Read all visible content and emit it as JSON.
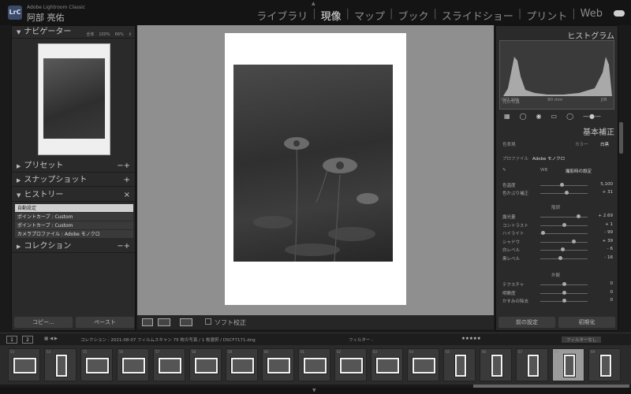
{
  "app": {
    "product": "Adobe Lightroom Classic",
    "user": "阿部 亮佑",
    "badge": "LrC"
  },
  "modules": [
    {
      "label": "ライブラリ",
      "active": false
    },
    {
      "label": "現像",
      "active": true
    },
    {
      "label": "マップ",
      "active": false
    },
    {
      "label": "ブック",
      "active": false
    },
    {
      "label": "スライドショー",
      "active": false
    },
    {
      "label": "プリント",
      "active": false
    },
    {
      "label": "Web",
      "active": false
    }
  ],
  "left": {
    "navigator": {
      "title": "ナビゲーター",
      "zoom_options": [
        "全体",
        "100%",
        "66%",
        "⇕"
      ]
    },
    "presets": "プリセット",
    "snapshots": "スナップショット",
    "history": {
      "title": "ヒストリー",
      "items": [
        {
          "label": "自動設定",
          "selected": true
        },
        {
          "label": "ポイントカーブ : Custom",
          "selected": false
        },
        {
          "label": "ポイントカーブ : Custom",
          "selected": false
        },
        {
          "label": "カメラプロファイル : Adobe モノクロ",
          "selected": false
        }
      ]
    },
    "collections": "コレクション",
    "copy_button": "コピー...",
    "paste_button": "ペースト"
  },
  "center": {
    "soft_proof": "ソフト校正"
  },
  "right": {
    "histogram_title": "ヒストグラム",
    "hist_info": {
      "iso": "ISO 200",
      "focal": "90 mm",
      "aperture": "ƒ/8"
    },
    "original_photo": "元の写真",
    "basic_title": "基本補正",
    "treatment_label": "色表現",
    "treatment_options": [
      "カラー",
      "白黒"
    ],
    "profile_label": "プロファイル",
    "profile_value": "Adobe モノクロ",
    "wb_label": "WB",
    "wb_value": "撮影時の設定",
    "sliders_wb": [
      {
        "label": "色温度",
        "value": "5,100",
        "pos": 0.45
      },
      {
        "label": "色かぶり補正",
        "value": "+ 31",
        "pos": 0.55
      }
    ],
    "tone_title": "階調",
    "sliders_tone": [
      {
        "label": "露光量",
        "value": "+ 2.69",
        "pos": 0.8
      },
      {
        "label": "コントラスト",
        "value": "+ 1",
        "pos": 0.5
      },
      {
        "label": "ハイライト",
        "value": "- 99",
        "pos": 0.05
      },
      {
        "label": "シャドウ",
        "value": "+ 39",
        "pos": 0.7
      },
      {
        "label": "白レベル",
        "value": "- 6",
        "pos": 0.47
      },
      {
        "label": "黒レベル",
        "value": "- 16",
        "pos": 0.42
      }
    ],
    "presence_title": "外観",
    "sliders_presence": [
      {
        "label": "テクスチャ",
        "value": "0",
        "pos": 0.5
      },
      {
        "label": "明瞭度",
        "value": "0",
        "pos": 0.5
      },
      {
        "label": "かすみの除去",
        "value": "0",
        "pos": 0.5
      }
    ],
    "prev_button": "前の設定",
    "reset_button": "初期化"
  },
  "filmstrip": {
    "pages": [
      "1",
      "2"
    ],
    "path": "コレクション : 2021-08-07 フィルムスキャン   75 枚の写真 / 1 枚選択 / DSCF7171.dng",
    "filter_label": "フィルター :",
    "filter_value": "フィルターなし",
    "thumbs": [
      "53",
      "54",
      "55",
      "56",
      "57",
      "58",
      "59",
      "60",
      "61",
      "62",
      "63",
      "64",
      "65",
      "66",
      "67",
      "68",
      "69"
    ],
    "selected_index": 15
  }
}
